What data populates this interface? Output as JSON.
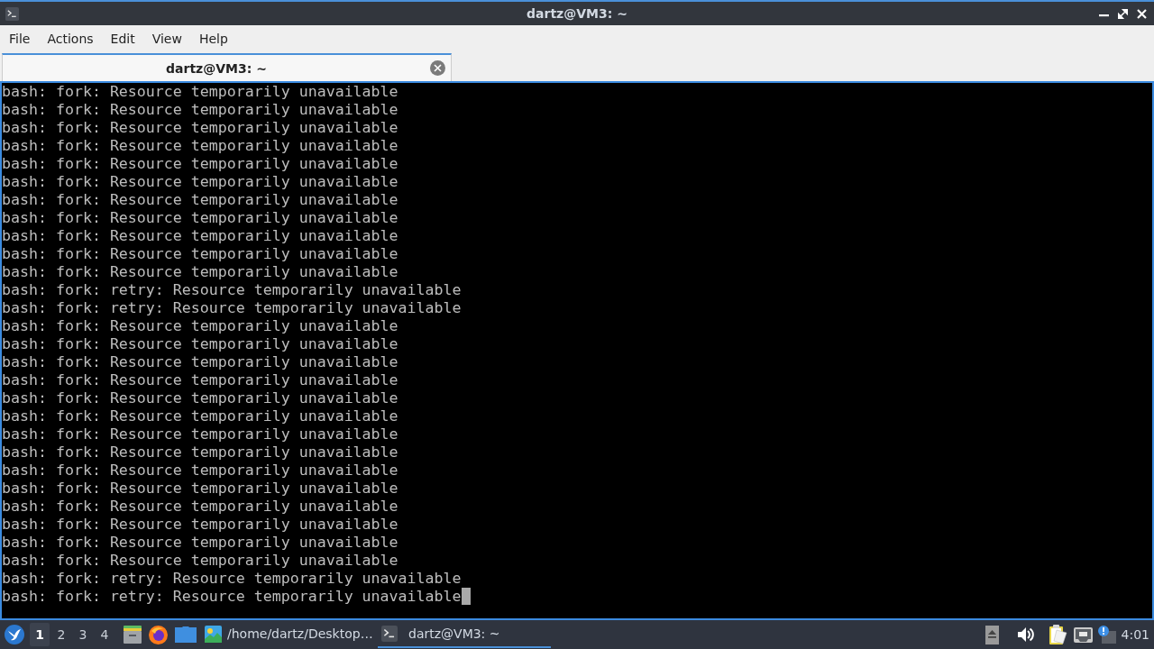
{
  "window": {
    "title": "dartz@VM3: ~"
  },
  "menu": [
    "File",
    "Actions",
    "Edit",
    "View",
    "Help"
  ],
  "tabs": [
    {
      "label": "dartz@VM3: ~",
      "selected": true
    }
  ],
  "terminal": {
    "lines": [
      "bash: fork: Resource temporarily unavailable",
      "bash: fork: Resource temporarily unavailable",
      "bash: fork: Resource temporarily unavailable",
      "bash: fork: Resource temporarily unavailable",
      "bash: fork: Resource temporarily unavailable",
      "bash: fork: Resource temporarily unavailable",
      "bash: fork: Resource temporarily unavailable",
      "bash: fork: Resource temporarily unavailable",
      "bash: fork: Resource temporarily unavailable",
      "bash: fork: Resource temporarily unavailable",
      "bash: fork: Resource temporarily unavailable",
      "bash: fork: retry: Resource temporarily unavailable",
      "bash: fork: retry: Resource temporarily unavailable",
      "bash: fork: Resource temporarily unavailable",
      "bash: fork: Resource temporarily unavailable",
      "bash: fork: Resource temporarily unavailable",
      "bash: fork: Resource temporarily unavailable",
      "bash: fork: Resource temporarily unavailable",
      "bash: fork: Resource temporarily unavailable",
      "bash: fork: Resource temporarily unavailable",
      "bash: fork: Resource temporarily unavailable",
      "bash: fork: Resource temporarily unavailable",
      "bash: fork: Resource temporarily unavailable",
      "bash: fork: Resource temporarily unavailable",
      "bash: fork: Resource temporarily unavailable",
      "bash: fork: Resource temporarily unavailable",
      "bash: fork: Resource temporarily unavailable",
      "bash: fork: retry: Resource temporarily unavailable",
      "bash: fork: retry: Resource temporarily unavailable"
    ],
    "cursor": true
  },
  "taskbar": {
    "workspaces": [
      {
        "label": "1",
        "selected": true
      },
      {
        "label": "2",
        "selected": false
      },
      {
        "label": "3",
        "selected": false
      },
      {
        "label": "4",
        "selected": false
      }
    ],
    "tasks": [
      {
        "kind": "image",
        "label": "/home/dartz/Desktop…",
        "selected": false
      },
      {
        "kind": "terminal",
        "label": "dartz@VM3: ~",
        "selected": true
      }
    ],
    "clock": "4:01"
  }
}
